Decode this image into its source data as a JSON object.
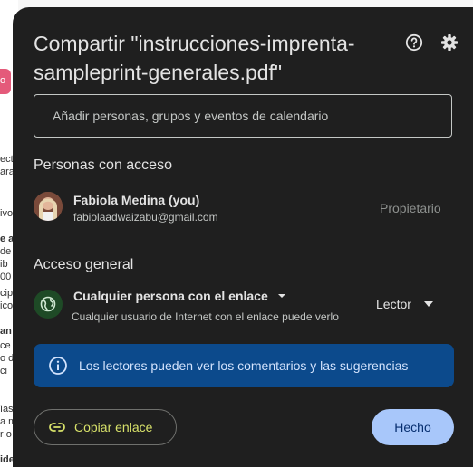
{
  "background_fragments": [
    "o",
    "ect",
    "ara",
    "ivo",
    "e a",
    "de",
    "ib",
    "00",
    "cip",
    "ico",
    "an",
    "ce",
    "o d",
    "ci",
    "ías",
    "a m",
    "r o",
    "ide"
  ],
  "dialog": {
    "title": "Compartir \"instrucciones-imprenta-sampleprint-generales.pdf\"",
    "help_icon": "help-circle-icon",
    "settings_icon": "gear-icon"
  },
  "add_people": {
    "placeholder": "Añadir personas, grupos y eventos de calendario"
  },
  "people_section": {
    "title": "Personas con acceso",
    "people": [
      {
        "name": "Fabiola Medina (you)",
        "email": "fabiolaadwaizabu@gmail.com",
        "role": "Propietario"
      }
    ]
  },
  "general_access": {
    "title": "Acceso general",
    "option": "Cualquier persona con el enlace",
    "description": "Cualquier usuario de Internet con el enlace puede verlo",
    "role": "Lector"
  },
  "info_banner": {
    "text": "Los lectores pueden ver los comentarios y las sugerencias",
    "icon": "info-icon"
  },
  "buttons": {
    "copy_link": "Copiar enlace",
    "done": "Hecho"
  },
  "colors": {
    "dialog_bg": "#1f1f1f",
    "banner_bg": "#0c4a8c",
    "done_bg": "#a8c7fa",
    "copy_text": "#d8e26a",
    "globe_bg": "#1e4a26"
  }
}
